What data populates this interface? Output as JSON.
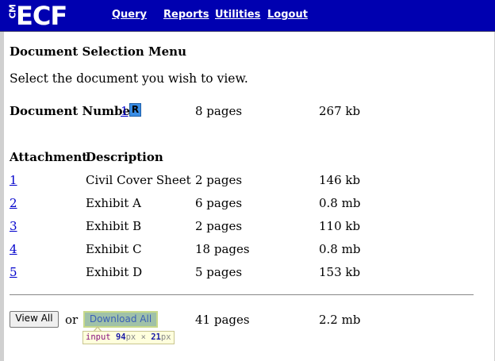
{
  "brand": {
    "logo_prefix": "CM",
    "logo_text": "ECF",
    "nav_color": "#0000b0"
  },
  "nav": {
    "query": "Query",
    "reports": "Reports",
    "utilities": "Utilities",
    "logout": "Logout"
  },
  "page": {
    "title": "Document Selection Menu",
    "instructions": "Select the document you wish to view."
  },
  "document": {
    "label": "Document Number:",
    "number": "1",
    "r_icon": "R",
    "pages": "8 pages",
    "size": "267 kb"
  },
  "table": {
    "headers": {
      "attachment": "Attachment",
      "description": "Description"
    },
    "rows": [
      {
        "num": "1",
        "description": "Civil Cover Sheet",
        "pages": "2 pages",
        "size": "146 kb"
      },
      {
        "num": "2",
        "description": "Exhibit A",
        "pages": "6 pages",
        "size": "0.8 mb"
      },
      {
        "num": "3",
        "description": "Exhibit B",
        "pages": "2 pages",
        "size": "110 kb"
      },
      {
        "num": "4",
        "description": "Exhibit C",
        "pages": "18 pages",
        "size": "0.8 mb"
      },
      {
        "num": "5",
        "description": "Exhibit D",
        "pages": "5 pages",
        "size": "153 kb"
      }
    ]
  },
  "actions": {
    "view_all": "View All",
    "or": "or",
    "download_all": "Download All",
    "total_pages": "41 pages",
    "total_size": "2.2 mb"
  },
  "inspector_tooltip": {
    "tag": "input",
    "width": "94",
    "width_unit": "px",
    "times": "×",
    "height": "21",
    "height_unit": "px"
  }
}
